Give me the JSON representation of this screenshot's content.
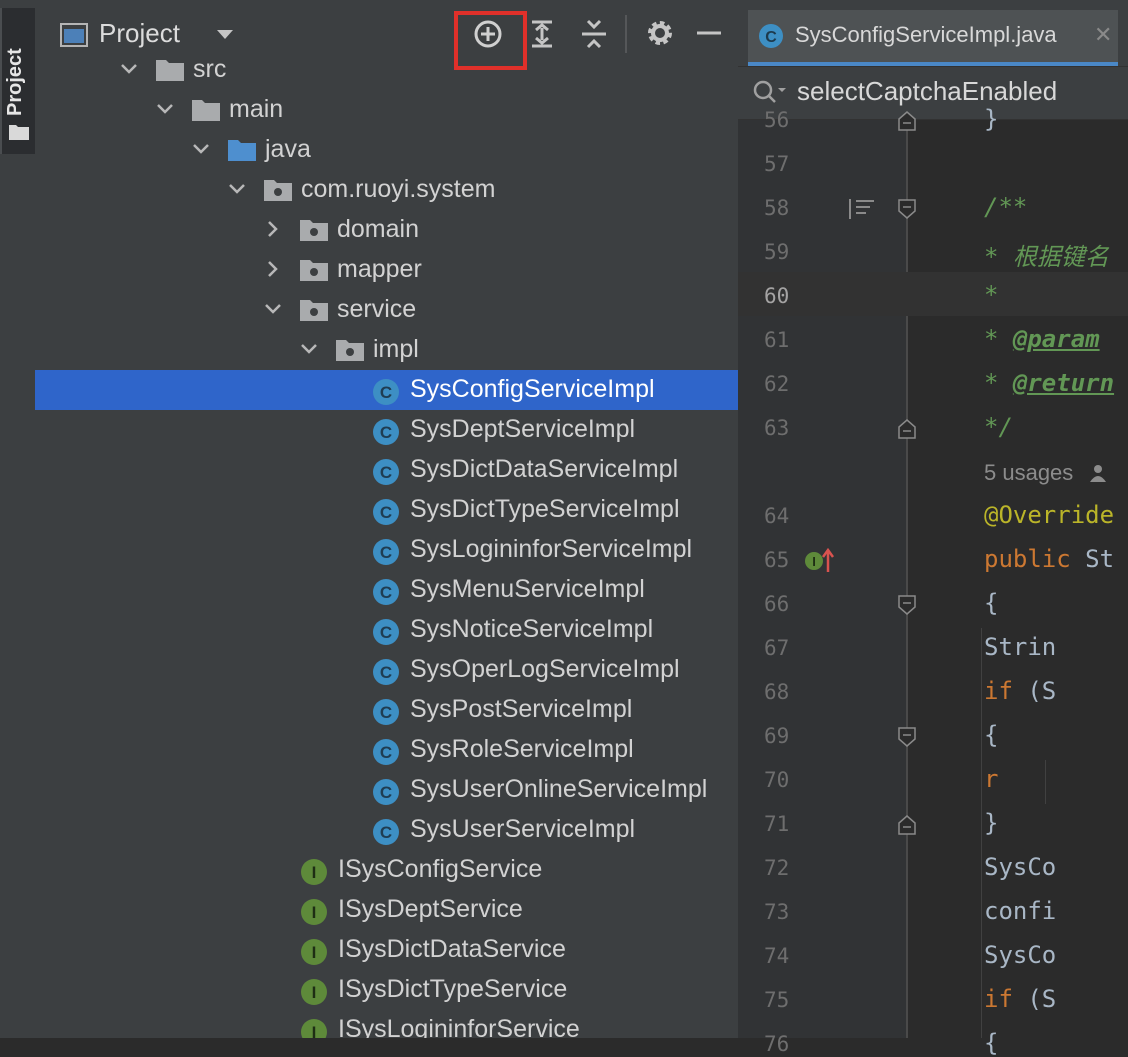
{
  "sidebar_stripe": {
    "label": "Project"
  },
  "project_panel": {
    "title": "Project"
  },
  "tree": [
    {
      "label": "src",
      "type": "folder",
      "depth": 0,
      "expanded": true
    },
    {
      "label": "main",
      "type": "folder",
      "depth": 1,
      "expanded": true
    },
    {
      "label": "java",
      "type": "source-folder",
      "depth": 2,
      "expanded": true
    },
    {
      "label": "com.ruoyi.system",
      "type": "package",
      "depth": 3,
      "expanded": true
    },
    {
      "label": "domain",
      "type": "package",
      "depth": 4,
      "expanded": false
    },
    {
      "label": "mapper",
      "type": "package",
      "depth": 4,
      "expanded": false
    },
    {
      "label": "service",
      "type": "package",
      "depth": 4,
      "expanded": true
    },
    {
      "label": "impl",
      "type": "package",
      "depth": 5,
      "expanded": true
    },
    {
      "label": "SysConfigServiceImpl",
      "type": "class",
      "depth": 6,
      "selected": true
    },
    {
      "label": "SysDeptServiceImpl",
      "type": "class",
      "depth": 6
    },
    {
      "label": "SysDictDataServiceImpl",
      "type": "class",
      "depth": 6
    },
    {
      "label": "SysDictTypeServiceImpl",
      "type": "class",
      "depth": 6
    },
    {
      "label": "SysLogininforServiceImpl",
      "type": "class",
      "depth": 6
    },
    {
      "label": "SysMenuServiceImpl",
      "type": "class",
      "depth": 6
    },
    {
      "label": "SysNoticeServiceImpl",
      "type": "class",
      "depth": 6
    },
    {
      "label": "SysOperLogServiceImpl",
      "type": "class",
      "depth": 6
    },
    {
      "label": "SysPostServiceImpl",
      "type": "class",
      "depth": 6
    },
    {
      "label": "SysRoleServiceImpl",
      "type": "class",
      "depth": 6
    },
    {
      "label": "SysUserOnlineServiceImpl",
      "type": "class",
      "depth": 6
    },
    {
      "label": "SysUserServiceImpl",
      "type": "class",
      "depth": 6
    },
    {
      "label": "ISysConfigService",
      "type": "interface",
      "depth": 5
    },
    {
      "label": "ISysDeptService",
      "type": "interface",
      "depth": 5
    },
    {
      "label": "ISysDictDataService",
      "type": "interface",
      "depth": 5
    },
    {
      "label": "ISysDictTypeService",
      "type": "interface",
      "depth": 5
    },
    {
      "label": "ISysLogininforService",
      "type": "interface",
      "depth": 5
    }
  ],
  "editor": {
    "tab_label": "SysConfigServiceImpl.java",
    "search_value": "selectCaptchaEnabled",
    "current_line": "60",
    "lines": [
      {
        "n": "56",
        "parts": [
          {
            "t": "}",
            "c": "plain"
          }
        ]
      },
      {
        "n": "57",
        "parts": []
      },
      {
        "n": "58",
        "parts": [
          {
            "t": "/**",
            "c": "doc"
          }
        ]
      },
      {
        "n": "59",
        "parts": [
          {
            "t": " * 根据键名",
            "c": "doc"
          }
        ]
      },
      {
        "n": "60",
        "parts": [
          {
            "t": " *",
            "c": "doc"
          }
        ]
      },
      {
        "n": "61",
        "parts": [
          {
            "t": " * ",
            "c": "doc"
          },
          {
            "t": "@param",
            "c": "tag"
          }
        ]
      },
      {
        "n": "62",
        "parts": [
          {
            "t": " * ",
            "c": "doc"
          },
          {
            "t": "@return",
            "c": "tag"
          }
        ]
      },
      {
        "n": "63",
        "parts": [
          {
            "t": " */",
            "c": "doc"
          }
        ]
      },
      {
        "n": "",
        "parts": [
          {
            "t": "5 usages",
            "c": "hint"
          }
        ]
      },
      {
        "n": "64",
        "parts": [
          {
            "t": "@Override",
            "c": "ann"
          }
        ]
      },
      {
        "n": "65",
        "parts": [
          {
            "t": "public ",
            "c": "kw"
          },
          {
            "t": "St",
            "c": "plain"
          }
        ]
      },
      {
        "n": "66",
        "parts": [
          {
            "t": "{",
            "c": "plain"
          }
        ]
      },
      {
        "n": "67",
        "parts": [
          {
            "t": "    Strin",
            "c": "plain"
          }
        ]
      },
      {
        "n": "68",
        "parts": [
          {
            "t": "    ",
            "c": "plain"
          },
          {
            "t": "if ",
            "c": "kw"
          },
          {
            "t": "(S",
            "c": "plain"
          }
        ]
      },
      {
        "n": "69",
        "parts": [
          {
            "t": "    {",
            "c": "plain"
          }
        ]
      },
      {
        "n": "70",
        "parts": [
          {
            "t": "        r",
            "c": "kw"
          }
        ]
      },
      {
        "n": "71",
        "parts": [
          {
            "t": "    }",
            "c": "plain"
          }
        ]
      },
      {
        "n": "72",
        "parts": [
          {
            "t": "    SysCo",
            "c": "plain"
          }
        ]
      },
      {
        "n": "73",
        "parts": [
          {
            "t": "    confi",
            "c": "plain"
          }
        ]
      },
      {
        "n": "74",
        "parts": [
          {
            "t": "    SysCo",
            "c": "plain"
          }
        ]
      },
      {
        "n": "75",
        "parts": [
          {
            "t": "    ",
            "c": "plain"
          },
          {
            "t": "if ",
            "c": "kw"
          },
          {
            "t": "(S",
            "c": "plain"
          }
        ]
      },
      {
        "n": "76",
        "parts": [
          {
            "t": "    {",
            "c": "plain"
          }
        ]
      }
    ]
  },
  "colors": {
    "selection": "#2f65ca",
    "highlight_box": "#e0302a",
    "class_icon": "#3d8fc4",
    "interface_icon": "#5e8a3a"
  }
}
